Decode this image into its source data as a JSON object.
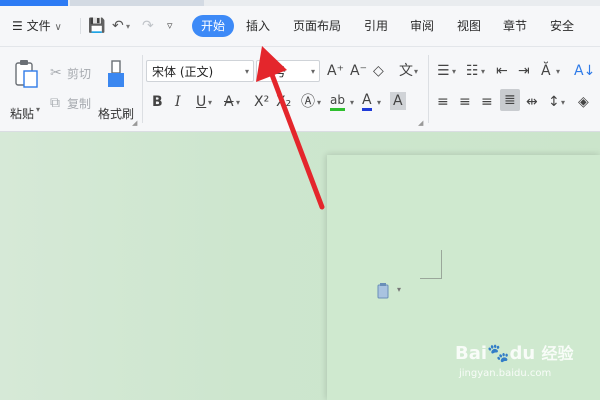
{
  "menubar": {
    "file_label": "文件",
    "tabs": [
      "开始",
      "插入",
      "页面布局",
      "引用",
      "审阅",
      "视图",
      "章节",
      "安全"
    ],
    "active_tab": "开始"
  },
  "ribbon": {
    "paste_label": "粘贴",
    "cut_label": "剪切",
    "copy_label": "复制",
    "format_painter_label": "格式刷",
    "font_name": "宋体 (正文)",
    "font_size": "五号"
  },
  "watermark": {
    "brand": "Bai",
    "brand2": "du",
    "suffix": "经验",
    "url": "jingyan.baidu.com"
  },
  "colors": {
    "accent": "#3d8af7",
    "arrow": "#e4262c",
    "canvas": "#cfe6cd"
  }
}
